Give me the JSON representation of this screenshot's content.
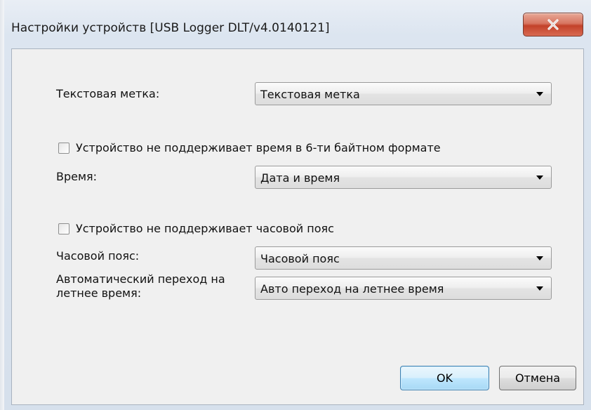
{
  "window": {
    "title": "Настройки устройств [USB Logger DLT/v4.0140121]",
    "close_icon": "close-x-icon"
  },
  "form": {
    "text_label": {
      "label": "Текстовая метка:",
      "value": "Текстовая метка"
    },
    "time_format_checkbox": {
      "label": "Устройство не поддерживает время в 6-ти байтном формате",
      "checked": false
    },
    "time": {
      "label": "Время:",
      "value": "Дата и время"
    },
    "timezone_checkbox": {
      "label": "Устройство не поддерживает часовой пояс",
      "checked": false
    },
    "timezone": {
      "label": "Часовой пояс:",
      "value": "Часовой пояс"
    },
    "dst": {
      "label": "Автоматический переход на летнее время:",
      "value": "Авто переход на летнее время"
    }
  },
  "buttons": {
    "ok": "OK",
    "cancel": "Отмена"
  }
}
